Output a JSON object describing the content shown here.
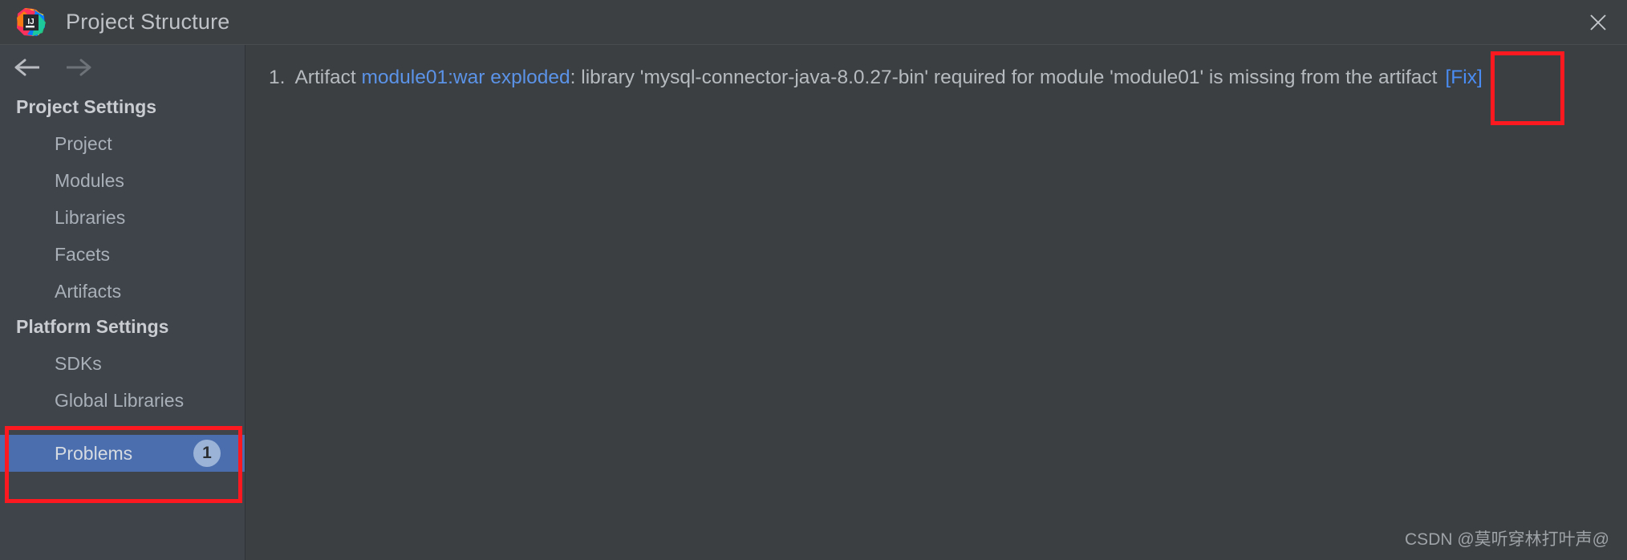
{
  "window": {
    "title": "Project Structure",
    "app_icon": "intellij-idea-logo",
    "close_icon": "close-icon"
  },
  "navigation": {
    "back_icon": "arrow-left-icon",
    "forward_icon": "arrow-right-icon"
  },
  "sidebar": {
    "groups": [
      {
        "header": "Project Settings",
        "items": [
          {
            "label": "Project"
          },
          {
            "label": "Modules"
          },
          {
            "label": "Libraries"
          },
          {
            "label": "Facets"
          },
          {
            "label": "Artifacts"
          }
        ]
      },
      {
        "header": "Platform Settings",
        "items": [
          {
            "label": "SDKs"
          },
          {
            "label": "Global Libraries"
          }
        ]
      }
    ],
    "problems": {
      "label": "Problems",
      "badge": "1",
      "selected": true
    }
  },
  "content": {
    "problem": {
      "number": "1.",
      "prefix": "Artifact",
      "artifact_link": "module01:war exploded",
      "message": ": library 'mysql-connector-java-8.0.27-bin' required for module 'module01' is missing from the artifact",
      "fix_label": "[Fix]"
    }
  },
  "watermark": {
    "text": "CSDN @莫听穿林打叶声@"
  },
  "colors": {
    "titlebar_bg": "#3c4043",
    "sidebar_bg": "#3f434a",
    "content_bg": "#3c3f41",
    "selection_blue": "#4b6eaf",
    "link_blue": "#5b93e8",
    "annotation_red": "#fc1a20",
    "badge_bg": "#9bb3d6"
  }
}
